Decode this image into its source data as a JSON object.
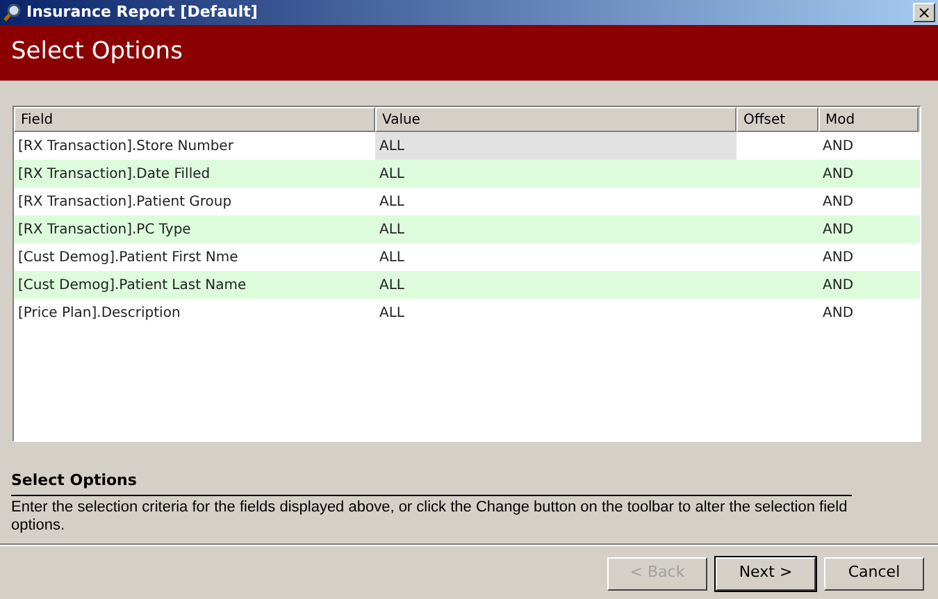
{
  "window": {
    "title": "Insurance Report [Default]",
    "close": "×"
  },
  "header": {
    "title": "Select Options"
  },
  "table": {
    "columns": [
      "Field",
      "Value",
      "Offset",
      "Mod"
    ],
    "rows": [
      {
        "field": "[RX Transaction].Store Number",
        "value": "ALL",
        "mod": "AND",
        "selected": true
      },
      {
        "field": "[RX Transaction].Date Filled",
        "value": "ALL",
        "mod": "AND",
        "selected": false
      },
      {
        "field": "[RX Transaction].Patient Group",
        "value": "ALL",
        "mod": "AND",
        "selected": false
      },
      {
        "field": "[RX Transaction].PC Type",
        "value": "ALL",
        "mod": "AND",
        "selected": false
      },
      {
        "field": "[Cust Demog].Patient First Nme",
        "value": "ALL",
        "mod": "AND",
        "selected": false
      },
      {
        "field": "[Cust Demog].Patient Last Name",
        "value": "ALL",
        "mod": "AND",
        "selected": false
      },
      {
        "field": "[Price Plan].Description",
        "value": "ALL",
        "mod": "AND",
        "selected": false
      }
    ]
  },
  "help": {
    "title": "Select Options",
    "text": "Enter the selection criteria for the fields displayed above, or click the Change button on the toolbar to alter the selection field options."
  },
  "buttons": [
    {
      "label": "< Back",
      "disabled": true,
      "default": false
    },
    {
      "label": "Next >",
      "disabled": false,
      "default": true
    },
    {
      "label": "Cancel",
      "disabled": false,
      "default": false
    }
  ]
}
